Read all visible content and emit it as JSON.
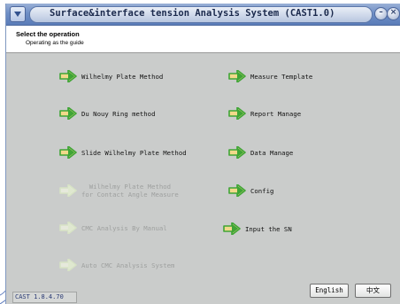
{
  "window": {
    "title": "Surface&interface tension Analysis System (CAST1.0)",
    "min_symbol": "–",
    "close_symbol": "×"
  },
  "header": {
    "title": "Select the operation",
    "subtitle": "Operating as the guide"
  },
  "left_menu": [
    {
      "label": "Wilhelmy Plate Method",
      "enabled": true
    },
    {
      "label": "Du Nouy Ring method",
      "enabled": true
    },
    {
      "label": "Slide Wilhelmy Plate Method",
      "enabled": true
    },
    {
      "label": "Wilhelmy Plate Method\nfor Contact Angle Measure",
      "enabled": false
    },
    {
      "label": "CMC Analysis By Manual",
      "enabled": false
    },
    {
      "label": "Auto CMC Analysis System",
      "enabled": false
    }
  ],
  "right_menu": [
    {
      "label": "Measure Template",
      "enabled": true
    },
    {
      "label": "Report Manage",
      "enabled": true
    },
    {
      "label": "Data Manage",
      "enabled": true
    },
    {
      "label": "Config",
      "enabled": true
    },
    {
      "label": "Input the SN",
      "enabled": true
    }
  ],
  "footer": {
    "version": "CAST 1.8.4.70",
    "english_button": "English",
    "chinese_button": "中文"
  },
  "colors": {
    "arrow_enabled": "#3fa536",
    "arrow_disabled": "#dfe8cf",
    "arrow_body": "#f1d98a",
    "background": "#cacccb"
  },
  "icons": {
    "arrow": "green-right-arrow-icon"
  }
}
